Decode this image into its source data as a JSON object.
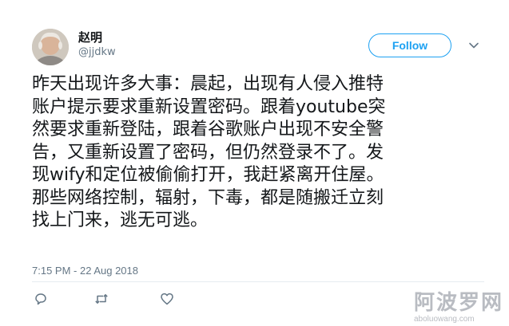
{
  "user": {
    "name": "赵明",
    "handle": "@jjdkw"
  },
  "follow_label": "Follow",
  "tweet": {
    "lines": [
      "昨天出现许多大事：晨起，出现有人侵入推特",
      "账户提示要求重新设置密码。跟着youtube突",
      "然要求重新登陆，跟着谷歌账户出现不安全警",
      "告，又重新设置了密码，但仍然登录不了。发",
      "现wify和定位被偷偷打开，我赶紧离开住屋。",
      "那些网络控制，辐射，下毒，都是随搬迁立刻",
      "找上门来，逃无可逃。"
    ]
  },
  "timestamp": "7:15 PM - 22 Aug 2018",
  "actions": {
    "reply_icon": "reply-icon",
    "retweet_icon": "retweet-icon",
    "like_icon": "heart-icon"
  },
  "watermark": {
    "title": "阿波罗网",
    "url": "aboluowang.com"
  },
  "colors": {
    "accent": "#1da1f2",
    "secondary_text": "#657786",
    "primary_text": "#14171a",
    "divider": "#e6ecf0"
  }
}
